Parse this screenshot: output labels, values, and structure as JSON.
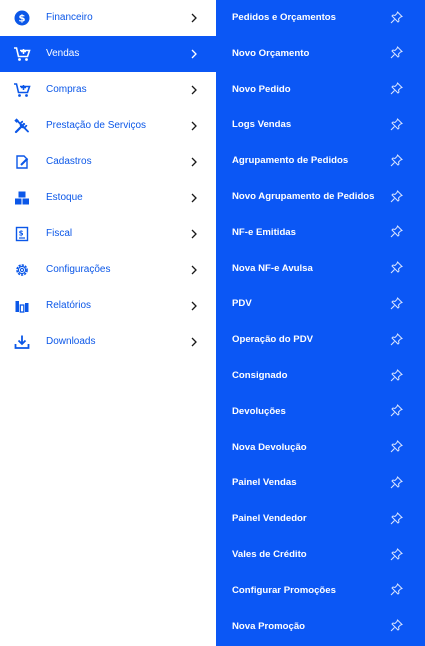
{
  "accent_color": "#0b57f5",
  "menu": {
    "items": [
      {
        "label": "Financeiro",
        "icon": "dollar-circle-icon",
        "active": false
      },
      {
        "label": "Vendas",
        "icon": "cart-plus-icon",
        "active": true
      },
      {
        "label": "Compras",
        "icon": "cart-plus-icon",
        "active": false
      },
      {
        "label": "Prestação de Serviços",
        "icon": "tools-icon",
        "active": false
      },
      {
        "label": "Cadastros",
        "icon": "edit-document-icon",
        "active": false
      },
      {
        "label": "Estoque",
        "icon": "boxes-icon",
        "active": false
      },
      {
        "label": "Fiscal",
        "icon": "receipt-icon",
        "active": false
      },
      {
        "label": "Configurações",
        "icon": "gear-icon",
        "active": false
      },
      {
        "label": "Relatórios",
        "icon": "bar-chart-icon",
        "active": false
      },
      {
        "label": "Downloads",
        "icon": "download-icon",
        "active": false
      }
    ]
  },
  "submenu": {
    "items": [
      {
        "label": "Pedidos e Orçamentos"
      },
      {
        "label": "Novo Orçamento"
      },
      {
        "label": "Novo Pedido"
      },
      {
        "label": "Logs Vendas"
      },
      {
        "label": "Agrupamento de Pedidos"
      },
      {
        "label": "Novo Agrupamento de Pedidos"
      },
      {
        "label": "NF-e Emitidas"
      },
      {
        "label": "Nova NF-e Avulsa"
      },
      {
        "label": "PDV"
      },
      {
        "label": "Operação do PDV"
      },
      {
        "label": "Consignado"
      },
      {
        "label": "Devoluções"
      },
      {
        "label": "Nova Devolução"
      },
      {
        "label": "Painel Vendas"
      },
      {
        "label": "Painel Vendedor"
      },
      {
        "label": "Vales de Crédito"
      },
      {
        "label": "Configurar Promoções"
      },
      {
        "label": "Nova Promoção"
      }
    ]
  }
}
